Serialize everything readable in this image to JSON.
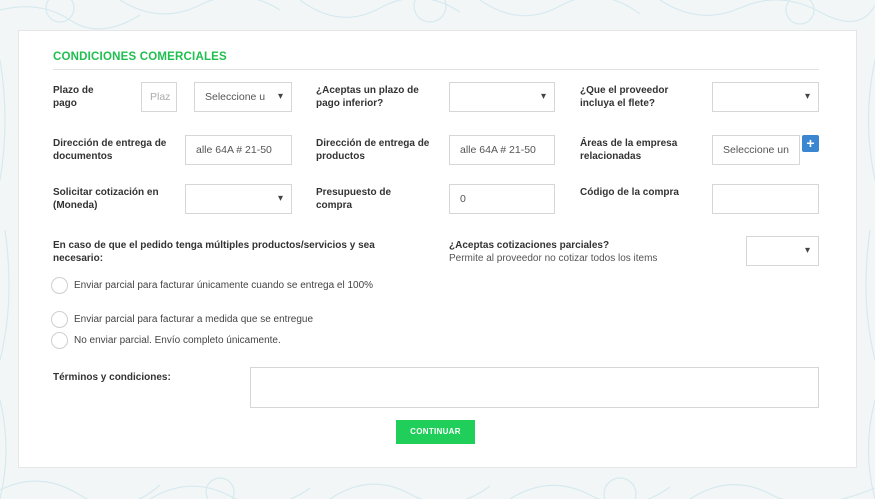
{
  "section": {
    "title": "CONDICIONES COMERCIALES"
  },
  "row1": {
    "plazo_label": "Plazo de pago",
    "plazo_placeholder": "Plaz",
    "plazo_unit": "Seleccione u",
    "aceptas_plazo_label": "¿Aceptas un plazo de pago inferior?",
    "aceptas_plazo_value": "",
    "flete_label": "¿Que el proveedor incluya el flete?",
    "flete_value": ""
  },
  "row2": {
    "dir_docs_label": "Dirección de entrega de documentos",
    "dir_docs_value": "alle 64A # 21-50",
    "dir_prod_label": "Dirección de entrega de productos",
    "dir_prod_value": "alle 64A # 21-50",
    "areas_label": "Áreas de la empresa relacionadas",
    "areas_value": "Seleccione un",
    "plus_symbol": "+"
  },
  "row3": {
    "moneda_label": "Solicitar cotización en (Moneda)",
    "moneda_value": "",
    "presupuesto_label": "Presupuesto de compra",
    "presupuesto_value": "0",
    "codigo_label": "Código de la compra",
    "codigo_value": ""
  },
  "multiples": {
    "question": "En caso de que el pedido tenga múltiples productos/servicios y sea necesario:",
    "options": [
      "Enviar parcial para facturar únicamente cuando se entrega el 100%",
      "Enviar parcial para facturar a medida que se entregue",
      "No enviar parcial. Envío completo únicamente."
    ]
  },
  "parciales": {
    "question": "¿Aceptas cotizaciones parciales?",
    "subtitle": "Permite al proveedor no cotizar todos los items",
    "value": ""
  },
  "terminos": {
    "label": "Términos y condiciones:",
    "value": ""
  },
  "actions": {
    "continue_label": "CONTINUAR"
  },
  "colors": {
    "accent_green": "#1fbf4f",
    "button_green": "#1fcf5a",
    "plus_blue": "#3a86d0"
  }
}
